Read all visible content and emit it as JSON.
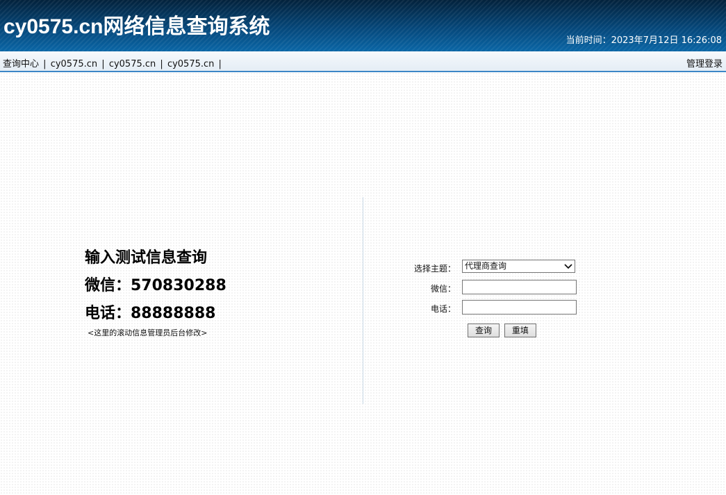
{
  "header": {
    "title": "cy0575.cn网络信息查询系统",
    "clock_label": "当前时间：",
    "clock_value": "2023年7月12日 16:26:08"
  },
  "nav": {
    "items": [
      {
        "label": "查询中心"
      },
      {
        "label": "cy0575.cn"
      },
      {
        "label": "cy0575.cn"
      },
      {
        "label": "cy0575.cn"
      }
    ],
    "separator": "|",
    "admin_login": "管理登录"
  },
  "info": {
    "line1": "输入测试信息查询",
    "line2": "微信：570830288",
    "line3": "电话：88888888",
    "note": "<这里的滚动信息管理员后台修改>"
  },
  "form": {
    "topic_label": "选择主题：",
    "topic_selected": "代理商查询",
    "wechat_label": "微信：",
    "wechat_value": "",
    "phone_label": "电话：",
    "phone_value": "",
    "query_button": "查询",
    "reset_button": "重填"
  },
  "icons": {
    "select_arrow": "chevron-down-icon"
  }
}
